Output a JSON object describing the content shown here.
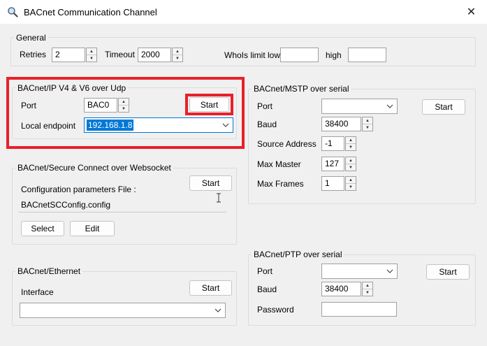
{
  "window": {
    "title": "BACnet Communication Channel",
    "close_glyph": "✕"
  },
  "general": {
    "legend": "General",
    "retries_label": "Retries",
    "retries_value": "2",
    "timeout_label": "Timeout",
    "timeout_value": "2000",
    "whois_label": "WhoIs limit low",
    "whois_low_value": "",
    "high_label": "high",
    "high_value": ""
  },
  "bacnet_ip": {
    "legend": "BACnet/IP V4 & V6 over Udp",
    "port_label": "Port",
    "port_value": "BAC0",
    "start_label": "Start",
    "endpoint_label": "Local endpoint",
    "endpoint_value": "192.168.1.8"
  },
  "bacnet_sc": {
    "legend": "BACnet/Secure Connect over Websocket",
    "config_label": "Configuration parameters File :",
    "config_value": "BACnetSCConfig.config",
    "start_label": "Start",
    "select_label": "Select",
    "edit_label": "Edit"
  },
  "bacnet_eth": {
    "legend": "BACnet/Ethernet",
    "interface_label": "Interface",
    "interface_value": "",
    "start_label": "Start"
  },
  "mstp": {
    "legend": "BACnet/MSTP over serial",
    "port_label": "Port",
    "port_value": "",
    "start_label": "Start",
    "baud_label": "Baud",
    "baud_value": "38400",
    "source_label": "Source Address",
    "source_value": "-1",
    "max_master_label": "Max Master",
    "max_master_value": "127",
    "max_frames_label": "Max Frames",
    "max_frames_value": "1"
  },
  "ptp": {
    "legend": "BACnet/PTP over serial",
    "port_label": "Port",
    "port_value": "",
    "start_label": "Start",
    "baud_label": "Baud",
    "baud_value": "38400",
    "password_label": "Password",
    "password_value": ""
  },
  "colors": {
    "highlight": "#e8202a",
    "selection": "#0078d7",
    "focus_border": "#0078d7"
  },
  "icons": [
    "search-app-icon",
    "close-icon",
    "spin-up-icon",
    "spin-down-icon",
    "chevron-down-icon",
    "text-cursor-icon"
  ]
}
